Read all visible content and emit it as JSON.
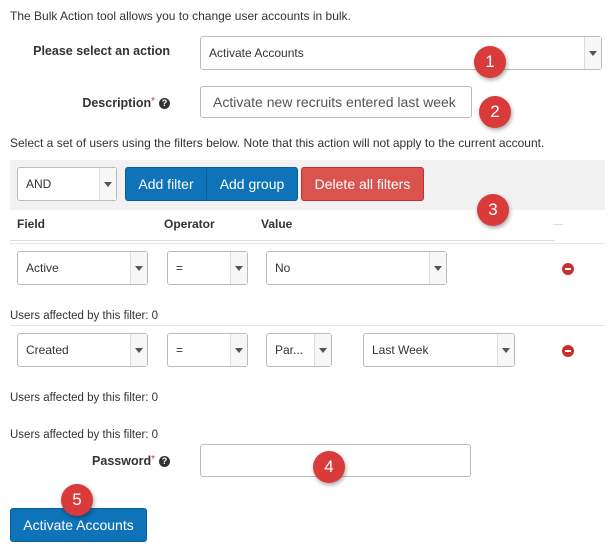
{
  "intro_text": "The Bulk Action tool allows you to change user accounts in bulk.",
  "action": {
    "label": "Please select an action",
    "value": "Activate Accounts"
  },
  "description": {
    "label": "Description",
    "required_mark": "*",
    "help_glyph": "?",
    "value": "Activate new recruits entered last week"
  },
  "filters_note": "Select a set of users using the filters below. Note that this action will not apply to the current account.",
  "filter_bar": {
    "logic_value": "AND",
    "add_filter": "Add filter",
    "add_group": "Add group",
    "delete_all": "Delete all filters"
  },
  "columns": {
    "field": "Field",
    "operator": "Operator",
    "value": "Value",
    "dash": "—"
  },
  "filters": [
    {
      "field": "Active",
      "operator": "=",
      "value": "No",
      "affected": "Users affected by this filter: 0"
    },
    {
      "field": "Created",
      "operator": "=",
      "value": "Par...",
      "value2": "Last Week",
      "affected": "Users affected by this filter: 0"
    }
  ],
  "total_affected": "Users affected by this filter: 0",
  "password": {
    "label": "Password",
    "required_mark": "*",
    "help_glyph": "?",
    "value": ""
  },
  "submit_label": "Activate Accounts",
  "badges": [
    "1",
    "2",
    "3",
    "4",
    "5"
  ],
  "colors": {
    "primary": "#0e73b8",
    "danger": "#d9534f",
    "badge": "#d93b3b"
  }
}
